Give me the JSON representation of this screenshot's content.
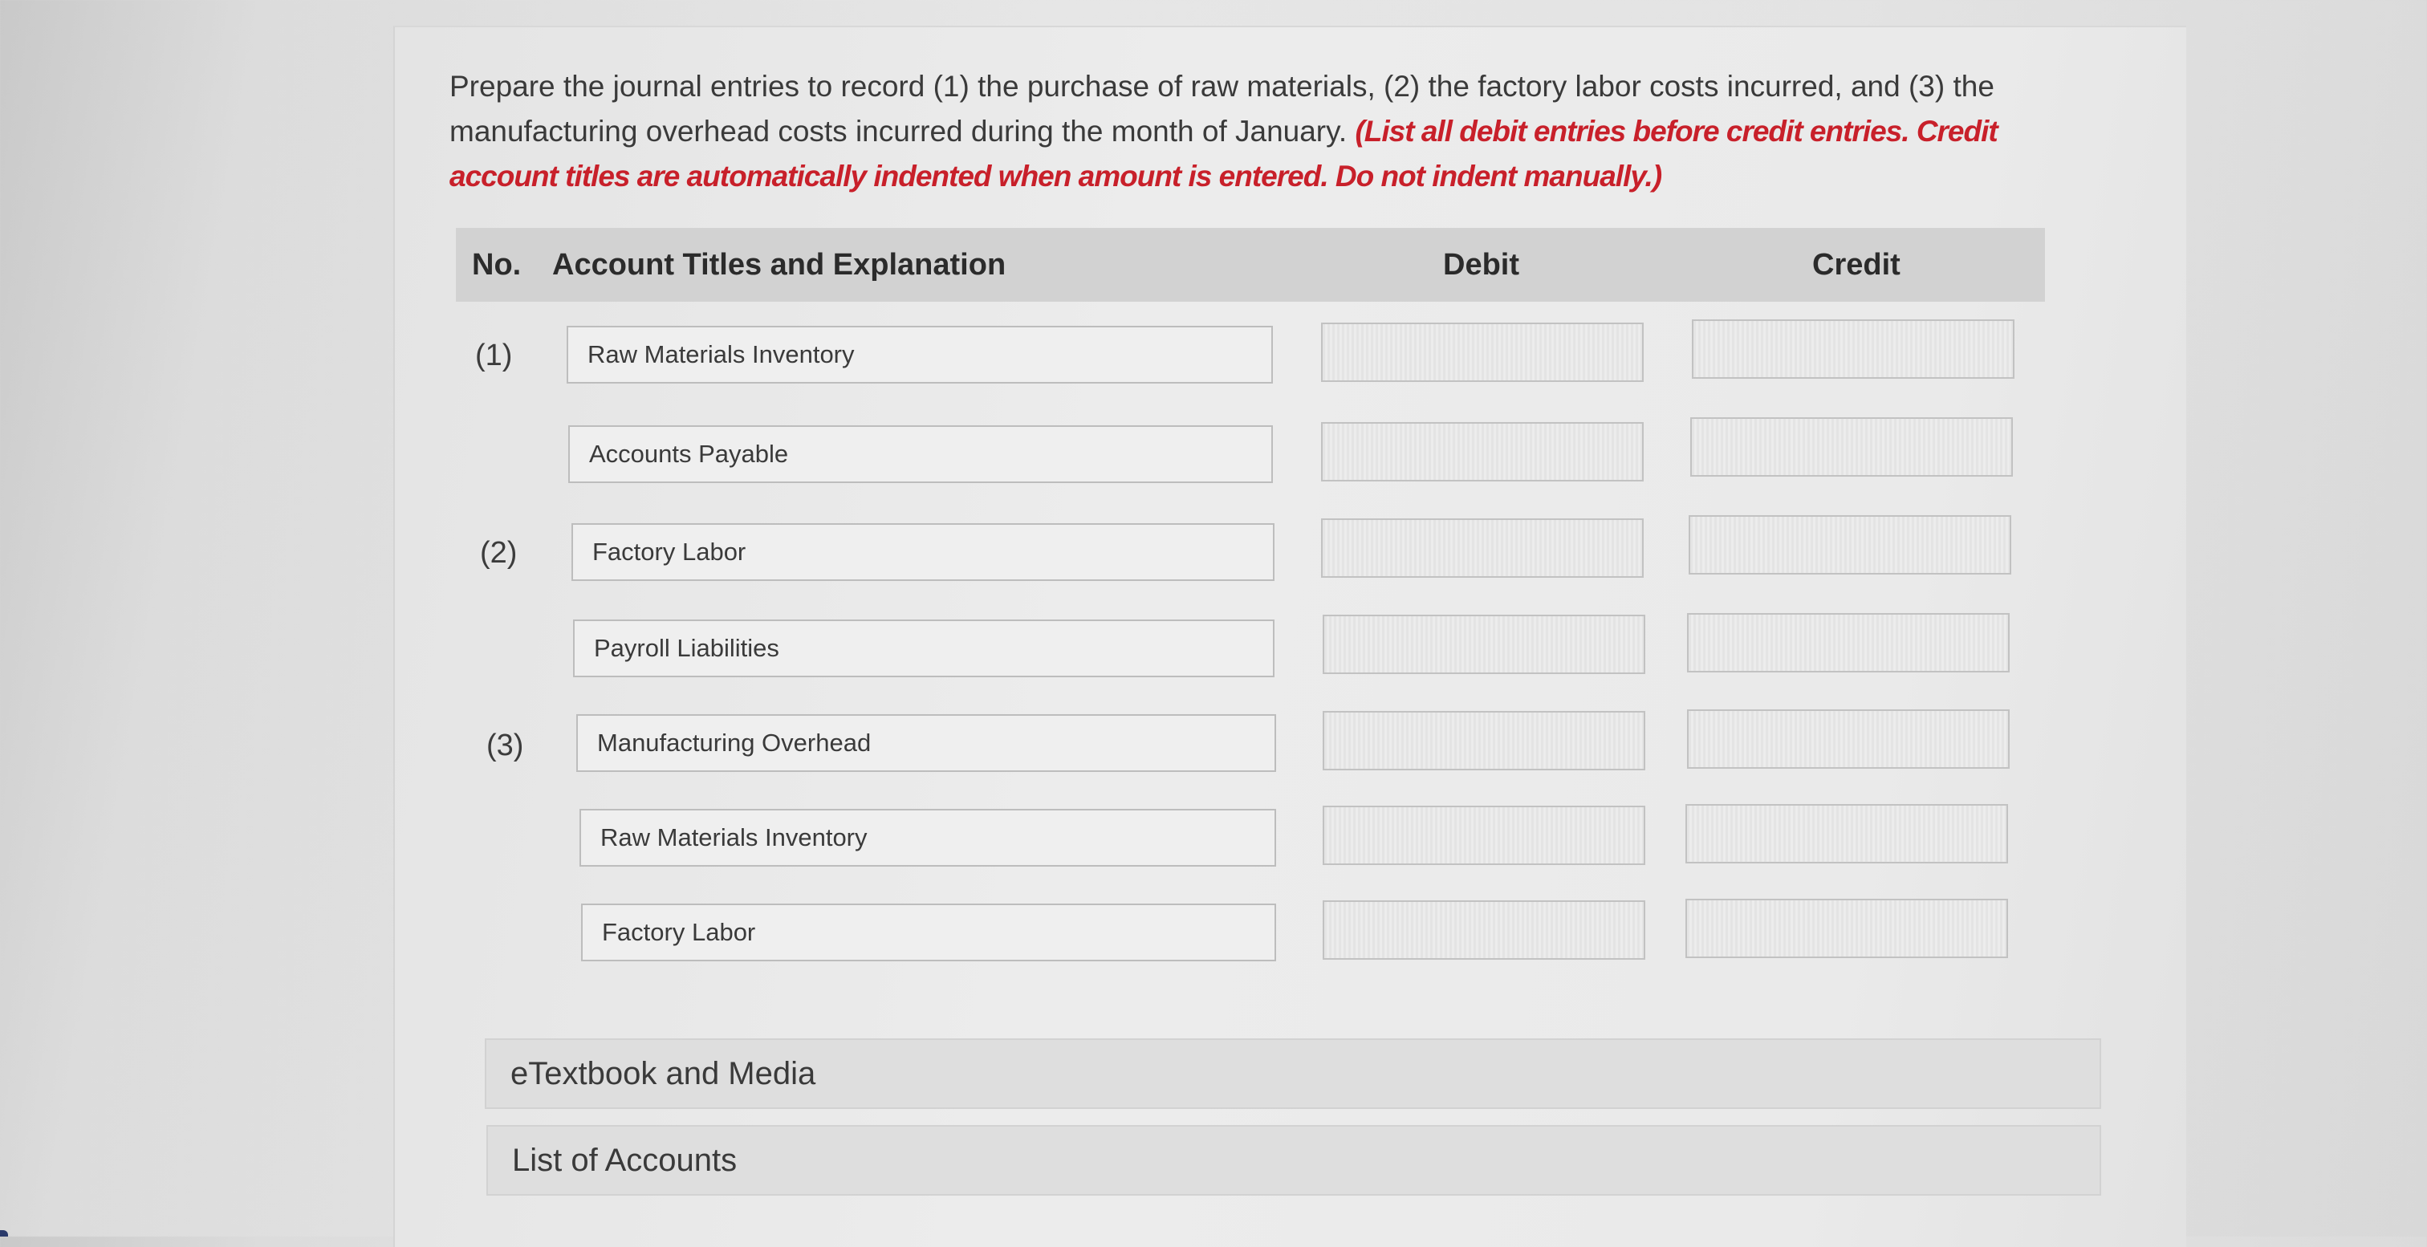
{
  "instructions": {
    "text": "Prepare the journal entries to record (1) the purchase of raw materials, (2) the factory labor costs incurred, and (3) the manufacturing overhead costs incurred during the month of January. ",
    "emphasis": "(List all debit entries before credit entries. Credit account titles are automatically indented when amount is entered. Do not indent manually.)"
  },
  "table": {
    "headers": {
      "no": "No.",
      "account": "Account Titles and Explanation",
      "debit": "Debit",
      "credit": "Credit"
    },
    "rows": [
      {
        "no": "(1)",
        "account": "Raw Materials Inventory",
        "debit": "",
        "credit": ""
      },
      {
        "no": "",
        "account": "Accounts Payable",
        "debit": "",
        "credit": ""
      },
      {
        "no": "(2)",
        "account": "Factory Labor",
        "debit": "",
        "credit": ""
      },
      {
        "no": "",
        "account": "Payroll Liabilities",
        "debit": "",
        "credit": ""
      },
      {
        "no": "(3)",
        "account": "Manufacturing Overhead",
        "debit": "",
        "credit": ""
      },
      {
        "no": "",
        "account": "Raw Materials Inventory",
        "debit": "",
        "credit": ""
      },
      {
        "no": "",
        "account": "Factory Labor",
        "debit": "",
        "credit": ""
      }
    ]
  },
  "links": {
    "etextbook": "eTextbook and Media",
    "accounts": "List of Accounts"
  }
}
